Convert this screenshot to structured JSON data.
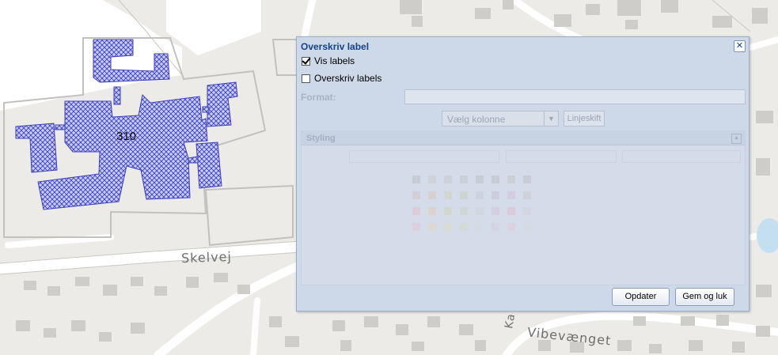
{
  "map": {
    "parcel_label": "310",
    "street_labels": {
      "skelvej": "Skelvej",
      "vibevaenget": "Vibevænget",
      "partial": "Ka"
    },
    "colors": {
      "background": "#ecebe8",
      "road": "#ffffff",
      "hatch": "#3b3fbf",
      "building": "#cfcdc9",
      "water": "#c4dff0"
    }
  },
  "dialog": {
    "title": "Overskriv label",
    "close_icon": "close-icon",
    "show_labels": {
      "label": "Vis labels",
      "checked": true
    },
    "override_labels": {
      "label": "Overskriv labels",
      "checked": false
    },
    "format_label": "Format:",
    "format_value": "",
    "column_select": "Vælg kolonne",
    "linebreak_label": "Linjeskift",
    "styling": {
      "title": "Styling"
    },
    "buttons": {
      "update": "Opdater",
      "save_close": "Gem og luk"
    }
  }
}
